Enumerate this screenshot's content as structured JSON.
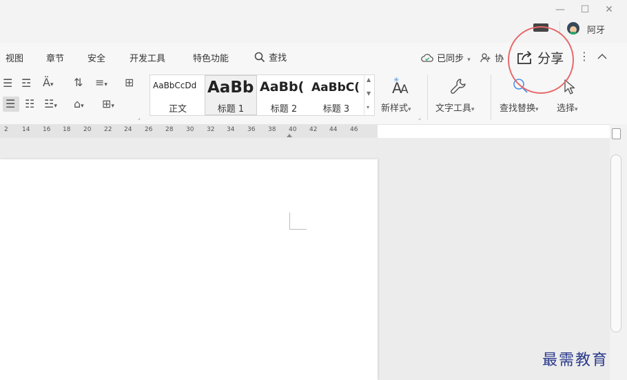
{
  "titlebar": {
    "window_controls": {
      "minimize": "—",
      "maximize": "☐",
      "close": "✕"
    },
    "user_name": "阿牙"
  },
  "menu": {
    "items": [
      "视图",
      "章节",
      "安全",
      "开发工具",
      "特色功能"
    ],
    "search_label": "查找",
    "sync_label": "已同步",
    "collab_label": "协",
    "share_label": "分享",
    "more_icon": "⋮",
    "collapse_icon": "^"
  },
  "ribbon": {
    "styles": [
      {
        "sample": "AaBbCcDd",
        "name": "正文"
      },
      {
        "sample": "AaBb",
        "name": "标题 1"
      },
      {
        "sample": "AaBb(",
        "name": "标题 2"
      },
      {
        "sample": "AaBbC(",
        "name": "标题 3"
      }
    ],
    "new_style_label": "新样式",
    "text_tools_label": "文字工具",
    "find_replace_label": "查找替换",
    "select_label": "选择"
  },
  "ruler": {
    "ticks": [
      "2",
      "14",
      "16",
      "18",
      "20",
      "22",
      "24",
      "26",
      "28",
      "30",
      "32",
      "34",
      "36",
      "38",
      "40",
      "42",
      "44",
      "46"
    ]
  },
  "watermark": "最需教育",
  "colors": {
    "accent_red": "#e8686a",
    "watermark_blue": "#2a3a8c"
  }
}
